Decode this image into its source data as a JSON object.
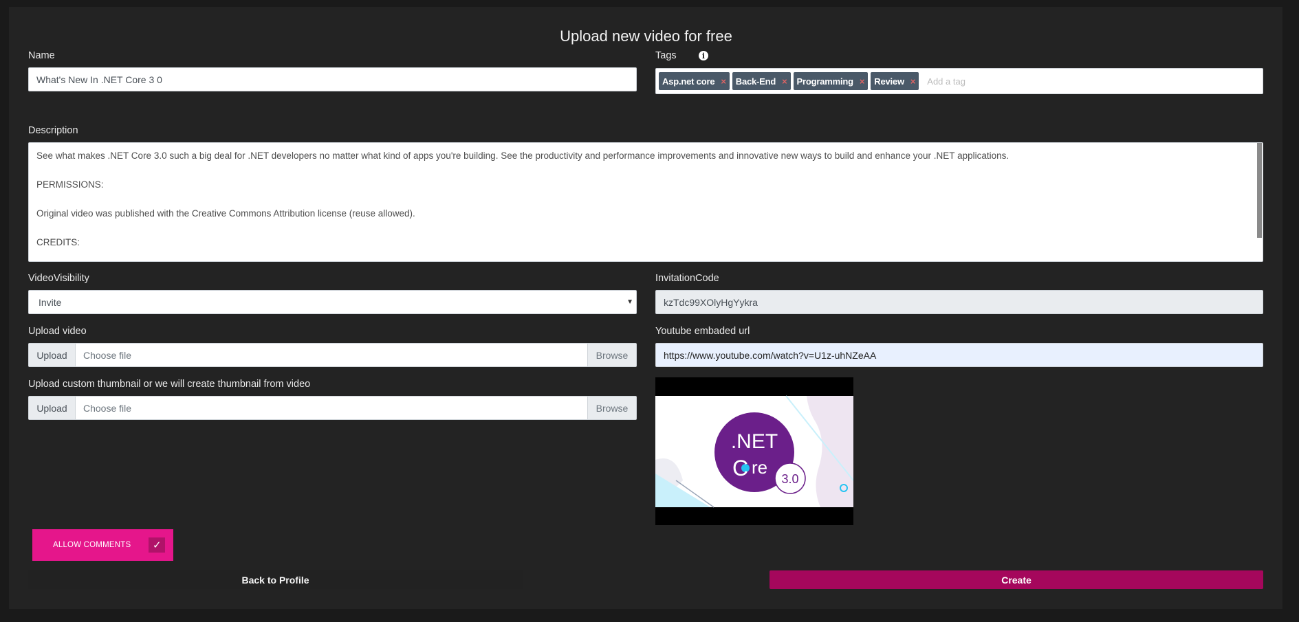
{
  "page": {
    "title": "Upload new video for free"
  },
  "name_field": {
    "label": "Name",
    "value": "What's New In .NET Core 3 0"
  },
  "tags_field": {
    "label": "Tags",
    "info_icon": "info-icon",
    "tags": [
      "Asp.net core",
      "Back-End",
      "Programming",
      "Review"
    ],
    "remove_glyph": "×",
    "placeholder": "Add a tag"
  },
  "description_field": {
    "label": "Description",
    "paragraphs": [
      "See what makes .NET Core 3.0 such a big deal for .NET developers no matter what kind of apps you're building. See the productivity and performance improvements and innovative new ways to build and enhance your .NET applications.",
      "PERMISSIONS:",
      "Original video was published with the Creative Commons Attribution license (reuse allowed).",
      "CREDITS:"
    ]
  },
  "visibility_field": {
    "label": "VideoVisibility",
    "value": "Invite",
    "arrow": "▼"
  },
  "invitation_field": {
    "label": "InvitationCode",
    "value": "kzTdc99XOlyHgYykra"
  },
  "upload_video": {
    "label": "Upload video",
    "prefix": "Upload",
    "placeholder": "Choose file",
    "browse": "Browse"
  },
  "youtube_field": {
    "label": "Youtube embaded url",
    "value": "https://www.youtube.com/watch?v=U1z-uhNZeAA"
  },
  "upload_thumbnail": {
    "label": "Upload custom thumbnail or we will create thumbnail from video",
    "prefix": "Upload",
    "placeholder": "Choose file",
    "browse": "Browse"
  },
  "thumbnail_logo": {
    "line1": ".NET",
    "core_c": "C",
    "core_re": "re",
    "version": "3.0"
  },
  "allow_comments": {
    "label": "ALLOW COMMENTS",
    "checked_glyph": "✓"
  },
  "buttons": {
    "back": "Back to Profile",
    "create": "Create"
  },
  "colors": {
    "accent": "#e5168b",
    "create": "#a5075c",
    "dotnet_purple": "#6b1f8a"
  }
}
